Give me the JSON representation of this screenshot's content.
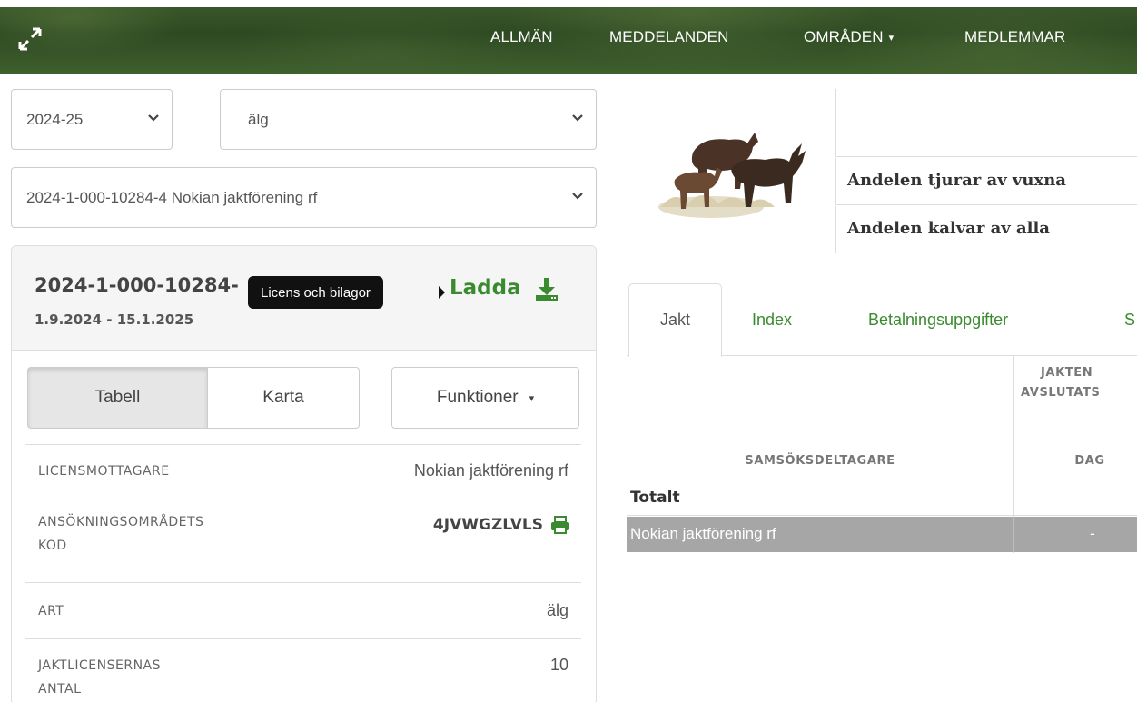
{
  "nav": {
    "items": [
      "ALLMÄN",
      "MEDDELANDEN",
      "OMRÅDEN",
      "MEDLEMMAR"
    ]
  },
  "filters": {
    "season": "2024-25",
    "species": "älg",
    "permit": "2024-1-000-10284-4 Nokian jaktförening rf"
  },
  "permit_panel": {
    "title": "2024-1-000-10284-",
    "dates": "1.9.2024 - 15.1.2025",
    "tooltip": "Licens och bilagor",
    "download_label": "Ladda",
    "tabs": [
      "Tabell",
      "Karta",
      "Funktioner"
    ],
    "rows": [
      {
        "label": "LICENSMOTTAGARE",
        "value": "Nokian jaktförening rf"
      },
      {
        "label_line1": "ANSÖKNINGSOMRÅDETS",
        "label_line2": "KOD",
        "value": "4JVWGZLVLS"
      },
      {
        "label": "ART",
        "value": "älg"
      },
      {
        "label_line1": "JAKTLICENSERNAS",
        "label_line2": "ANTAL",
        "value": "10"
      }
    ]
  },
  "stats": {
    "rows": [
      "Andelen tjurar av vuxna",
      "Andelen kalvar av alla"
    ]
  },
  "detail_tabs": [
    "Jakt",
    "Index",
    "Betalningsuppgifter",
    "S"
  ],
  "grid": {
    "col1_header": "SAMSÖKSDELTAGARE",
    "col2_header_line1": "JAKTEN",
    "col2_header_line2": "AVSLUTATS",
    "col2_header_sub": "DAG",
    "total_label": "Totalt",
    "member_name": "Nokian jaktförening rf",
    "member_value": "-"
  },
  "colors": {
    "accent_green": "#3a8a2f",
    "nav_bg": "#2d4a22"
  }
}
